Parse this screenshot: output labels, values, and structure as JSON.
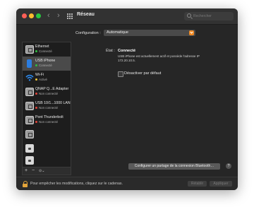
{
  "window": {
    "title": "Réseau"
  },
  "toolbar": {
    "back_glyph": "‹",
    "forward_glyph": "›",
    "grid_icon": "grid-icon",
    "search_placeholder": "Rechercher"
  },
  "configuration": {
    "label": "Configuration :",
    "value": "Automatique"
  },
  "sidebar": {
    "items": [
      {
        "name": "Ethernet",
        "status": "Connecté",
        "dot": "green",
        "icon": "ethernet-icon"
      },
      {
        "name": "USB iPhone",
        "status": "Connecté",
        "dot": "green",
        "icon": "iphone-icon"
      },
      {
        "name": "Wi-Fi",
        "status": "Activé",
        "dot": "yellow",
        "icon": "wifi-icon"
      },
      {
        "name": "QNAP Q...E Adapter",
        "status": "Non connecté",
        "dot": "red",
        "icon": "ethernet-icon"
      },
      {
        "name": "USB 10/1...1000 LAN",
        "status": "Non connecté",
        "dot": "red",
        "icon": "ethernet-icon"
      },
      {
        "name": "Pont Thunderbolt",
        "status": "Non connecté",
        "dot": "red",
        "icon": "ethernet-icon"
      }
    ],
    "footer": {
      "add": "+",
      "remove": "−",
      "more": "⊙⌄"
    }
  },
  "detail": {
    "status_label": "État :",
    "status_value": "Connecté",
    "status_description": "USB iPhone est actuellement actif et possède l'adresse IP 172.20.10.5.",
    "checkbox_label": "Désactiver par défaut",
    "checkbox_checked": false,
    "bluetooth_button": "Configurer un partage de la connexion Bluetooth…",
    "help": "?"
  },
  "footer": {
    "lock_text": "Pour empêcher les modifications, cliquez sur le cadenas.",
    "revert_button": "Rétablir",
    "apply_button": "Appliquer"
  },
  "colors": {
    "accent": "#f08a24",
    "green": "#2fbf3f",
    "red": "#e0443a",
    "yellow": "#f3c63a"
  }
}
